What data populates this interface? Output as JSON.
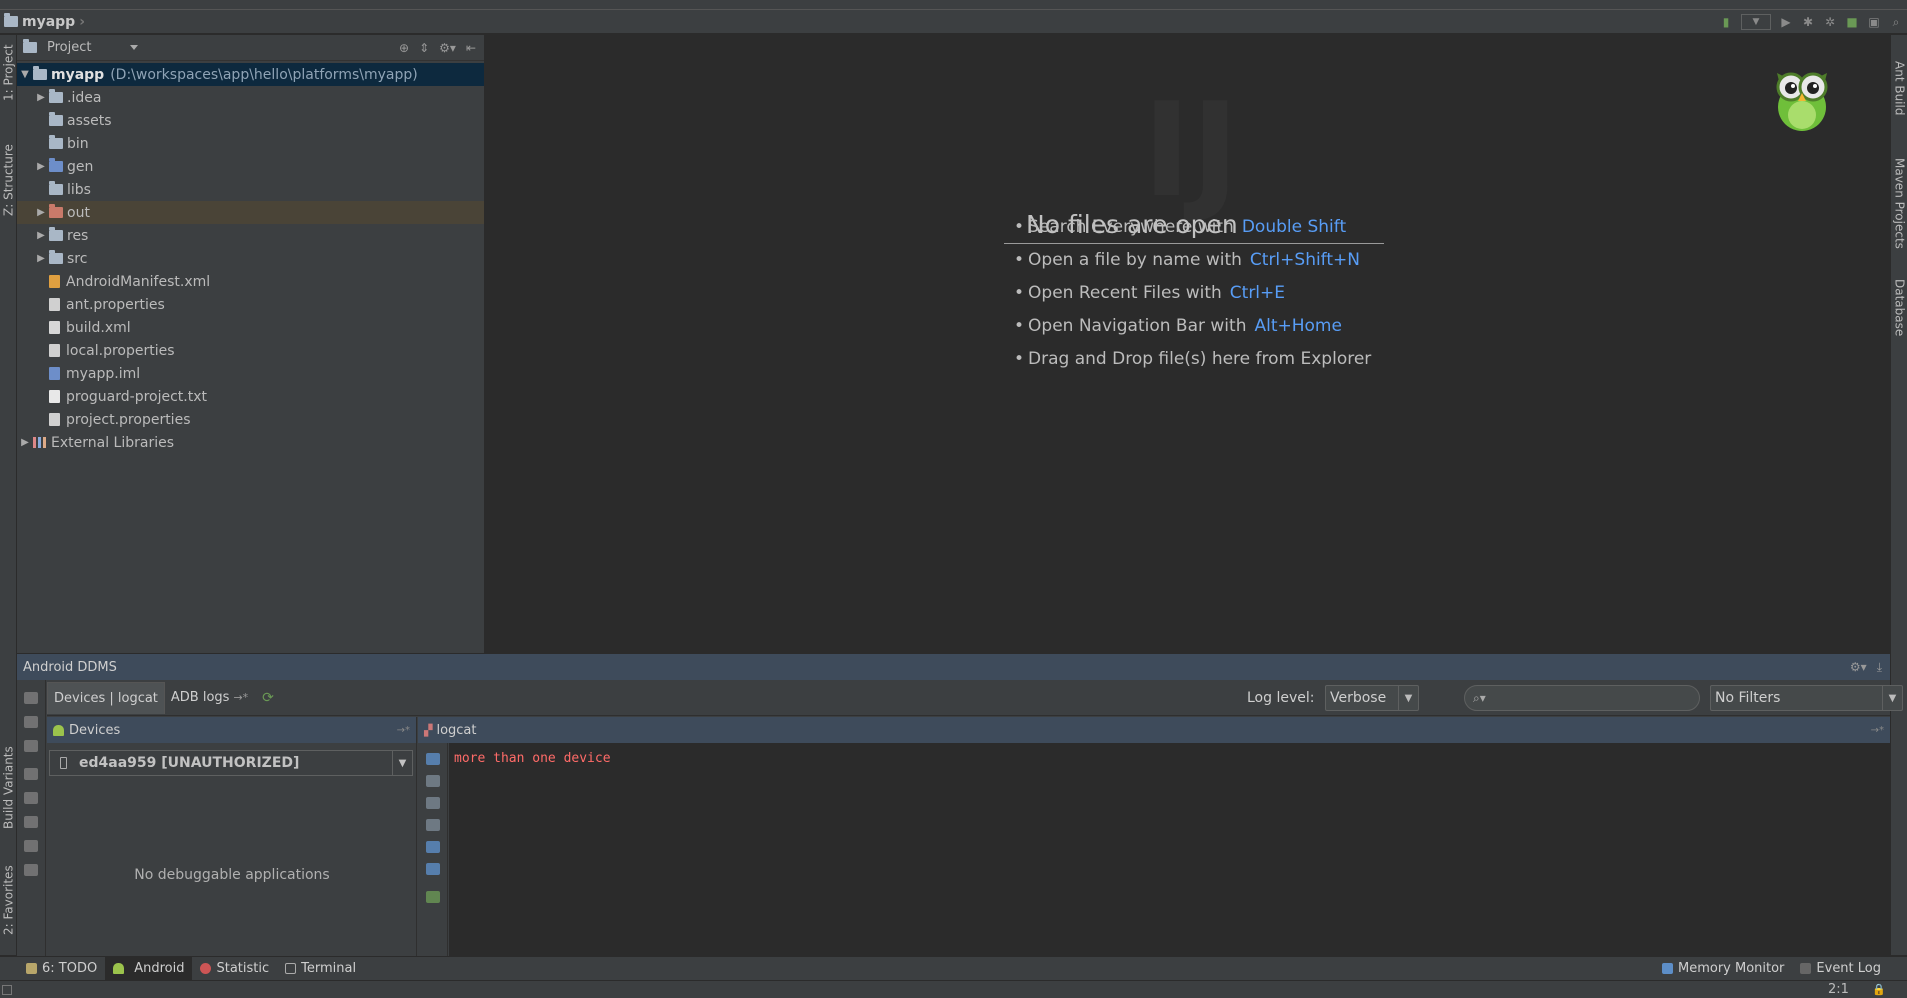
{
  "navbar": {
    "project_name": "myapp"
  },
  "project_panel": {
    "view_mode": "Project",
    "tree": [
      {
        "label": "myapp",
        "path": "(D:\\workspaces\\app\\hello\\platforms\\myapp)",
        "icon": "module-icon",
        "expanded": true,
        "selected": true,
        "depth": 0
      },
      {
        "label": ".idea",
        "icon": "folder-icon",
        "collapsed": true,
        "depth": 1
      },
      {
        "label": "assets",
        "icon": "folder-icon",
        "depth": 1
      },
      {
        "label": "bin",
        "icon": "folder-icon",
        "depth": 1
      },
      {
        "label": "gen",
        "icon": "source-folder-icon",
        "collapsed": true,
        "depth": 1
      },
      {
        "label": "libs",
        "icon": "folder-icon",
        "depth": 1
      },
      {
        "label": "out",
        "icon": "excluded-folder-icon",
        "collapsed": true,
        "depth": 1,
        "highlighted": true
      },
      {
        "label": "res",
        "icon": "folder-icon",
        "collapsed": true,
        "depth": 1
      },
      {
        "label": "src",
        "icon": "folder-icon",
        "collapsed": true,
        "depth": 1
      },
      {
        "label": "AndroidManifest.xml",
        "icon": "xml-file-icon",
        "depth": 1
      },
      {
        "label": "ant.properties",
        "icon": "properties-file-icon",
        "depth": 1
      },
      {
        "label": "build.xml",
        "icon": "ant-file-icon",
        "depth": 1
      },
      {
        "label": "local.properties",
        "icon": "properties-file-icon",
        "depth": 1
      },
      {
        "label": "myapp.iml",
        "icon": "iml-file-icon",
        "depth": 1
      },
      {
        "label": "proguard-project.txt",
        "icon": "text-file-icon",
        "depth": 1
      },
      {
        "label": "project.properties",
        "icon": "properties-file-icon",
        "depth": 1
      },
      {
        "label": "External Libraries",
        "icon": "library-icon",
        "collapsed": true,
        "depth": 0
      }
    ]
  },
  "left_strip": {
    "project": "1: Project",
    "structure": "Z: Structure",
    "build_variants": "Build Variants",
    "favorites": "2: Favorites"
  },
  "right_strip": {
    "ant": "Ant Build",
    "maven": "Maven Projects",
    "database": "Database"
  },
  "editor": {
    "empty_title": "No files are open",
    "hints": [
      {
        "text": "Search Everywhere with",
        "key": "Double Shift"
      },
      {
        "text": "Open a file by name with",
        "key": "Ctrl+Shift+N"
      },
      {
        "text": "Open Recent Files with",
        "key": "Ctrl+E"
      },
      {
        "text": "Open Navigation Bar with",
        "key": "Alt+Home"
      },
      {
        "text": "Drag and Drop file(s) here from Explorer",
        "key": ""
      }
    ]
  },
  "ddms": {
    "title": "Android DDMS",
    "tabs": {
      "devices_logcat": "Devices | logcat",
      "adb_logs": "ADB logs"
    },
    "log_level_label": "Log level:",
    "log_level_value": "Verbose",
    "filter_value": "No Filters",
    "devices_header": "Devices",
    "device_selected": "ed4aa959 [UNAUTHORIZED]",
    "no_debuggable": "No debuggable applications",
    "logcat_header": "logcat",
    "log_lines": [
      "more than one device"
    ]
  },
  "bottom_bar": {
    "todo": "6: TODO",
    "android": "Android",
    "statistic": "Statistic",
    "terminal": "Terminal",
    "memory_monitor": "Memory Monitor",
    "event_log": "Event Log"
  },
  "status": {
    "position": "2:1"
  },
  "colors": {
    "accent_key": "#589df6",
    "log_error": "#ff6b68",
    "selection": "#0d293e"
  }
}
